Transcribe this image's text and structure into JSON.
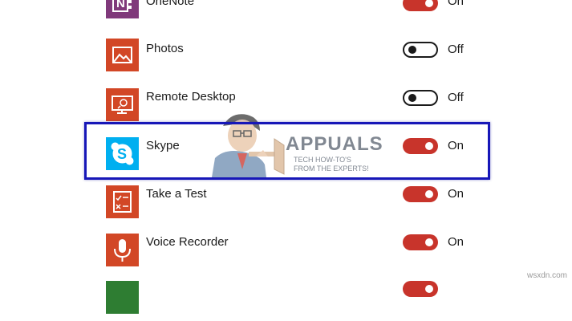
{
  "apps": [
    {
      "name": "OneNote",
      "state": "On",
      "icon": "onenote-icon",
      "color": "#80397b"
    },
    {
      "name": "Photos",
      "state": "Off",
      "icon": "photos-icon",
      "color": "#d24726"
    },
    {
      "name": "Remote Desktop",
      "state": "Off",
      "icon": "remote-desktop-icon",
      "color": "#d24726"
    },
    {
      "name": "Skype",
      "state": "On",
      "icon": "skype-icon",
      "color": "#00aff0"
    },
    {
      "name": "Take a Test",
      "state": "On",
      "icon": "take-a-test-icon",
      "color": "#d24726"
    },
    {
      "name": "Voice Recorder",
      "state": "On",
      "icon": "voice-recorder-icon",
      "color": "#d24726"
    },
    {
      "name": "",
      "state": "On",
      "icon": "app-icon",
      "color": "#2e7d32"
    }
  ],
  "highlighted_app": "Skype",
  "watermark": {
    "brand": "APPUALS",
    "tagline": "TECH HOW-TO'S FROM THE EXPERTS!"
  },
  "footer": "wsxdn.com",
  "colors": {
    "toggle_on": "#c8342b",
    "toggle_off_border": "#1a1a1a",
    "highlight_border": "#1717b8"
  }
}
